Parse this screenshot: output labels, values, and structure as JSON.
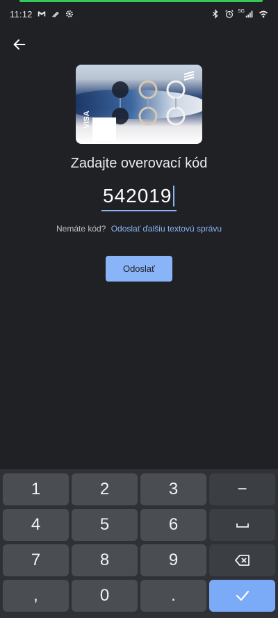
{
  "status_bar": {
    "time": "11:12",
    "network_label": "5G",
    "left_icons": [
      "gmail-icon",
      "pen-icon",
      "settings-icon"
    ],
    "right_icons": [
      "bluetooth-icon",
      "alarm-icon",
      "signal-icon",
      "wifi-icon"
    ]
  },
  "header": {
    "back_icon": "arrow-back-icon"
  },
  "card": {
    "network": "VISA"
  },
  "main": {
    "title": "Zadajte overovací kód",
    "code_value": "542019",
    "no_code_text": "Nemáte kód?",
    "resend_link": "Odoslať ďalšiu textovú správu",
    "submit_label": "Odoslať"
  },
  "keyboard": {
    "rows": [
      [
        "1",
        "2",
        "3",
        "−"
      ],
      [
        "4",
        "5",
        "6",
        "space"
      ],
      [
        "7",
        "8",
        "9",
        "backspace"
      ],
      [
        ",",
        "0",
        ".",
        "enter"
      ]
    ],
    "labels": {
      "k1": "1",
      "k2": "2",
      "k3": "3",
      "minus": "−",
      "k4": "4",
      "k5": "5",
      "k6": "6",
      "k7": "7",
      "k8": "8",
      "k9": "9",
      "comma": ",",
      "k0": "0",
      "period": "."
    }
  },
  "colors": {
    "background": "#202124",
    "accent": "#8ab4f8",
    "keyboard_bg": "#2f3136",
    "key_bg": "#4a4d52",
    "enter_key": "#7baaf7",
    "progress_bar": "#34c759"
  }
}
